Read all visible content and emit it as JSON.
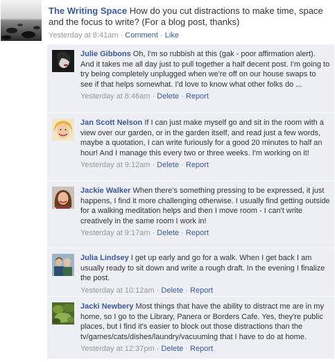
{
  "post": {
    "page_name": "The Writing Space",
    "text": "How do you cut distractions to make time, space and the focus to write? (For a blog post, thanks)",
    "timestamp": "Yesterday at 8:41am",
    "comment_label": "Comment",
    "like_label": "Like",
    "separator": "·"
  },
  "comments": [
    {
      "author": "Julie Gibbons",
      "text": "Oh, I'm so rubbish at this (gak - poor affirmation alert). And it takes me all day just to pull together a half decent post. I'm going to try being completely unplugged when we're off on our house swaps to see if that helps somewhat. I'd love to know what other folks do ...",
      "timestamp": "Yesterday at 8:46am",
      "delete_label": "Delete",
      "report_label": "Report"
    },
    {
      "author": "Jan Scott Nelson",
      "text": "If I can just make myself go and sit in the room with a view over our garden, or in the garden itself, and read just a few words, maybe a quotation, I can write furiously for a good 20 minutes to half an hour! And I manage this every two or three weeks. I'm working on it!",
      "timestamp": "Yesterday at 9:12am",
      "delete_label": "Delete",
      "report_label": "Report"
    },
    {
      "author": "Jackie Walker",
      "text": "When there's something pressing to be expressed, it just happens, I find it more challenging otherwise. I usually find getting outside for a walking meditation helps and then I move room - I can't write creatively in the same room I work in!",
      "timestamp": "Yesterday at 9:17am",
      "delete_label": "Delete",
      "report_label": "Report"
    },
    {
      "author": "Julia Lindsey",
      "text": "I get up early and go for a walk. When I get back I am usually ready to sit down and write a rough draft. In the evening I finalize the post.",
      "timestamp": "Yesterday at 10:12am",
      "delete_label": "Delete",
      "report_label": "Report"
    },
    {
      "author": "Jacki Newbery",
      "text": "Most things that have the ability to distract me are in my home, so I go to the Library, Panera or Borders Cafe. Yes, they're public places, but I find it's easier to block out those distractions than the tv/games/cats/dishes/laundry/vacuuming that I have to do at home.",
      "timestamp": "Yesterday at 12:37pm",
      "delete_label": "Delete",
      "report_label": "Report"
    }
  ],
  "colors": {
    "link": "#3b5998",
    "comment_bg": "#edeff4",
    "meta": "#999999",
    "text": "#333333"
  }
}
